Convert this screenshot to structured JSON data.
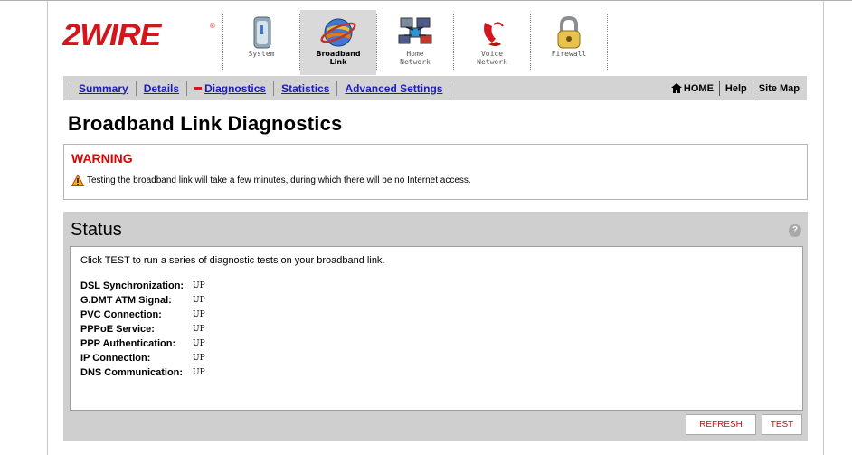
{
  "logo": {
    "text": "2WIRE",
    "reg": "®"
  },
  "topnav": [
    {
      "label": "System",
      "icon": "system-icon",
      "active": false
    },
    {
      "label": "Broadband\nLink",
      "icon": "globe-icon",
      "active": true
    },
    {
      "label": "Home\nNetwork",
      "icon": "network-icon",
      "active": false
    },
    {
      "label": "Voice\nNetwork",
      "icon": "phone-icon",
      "active": false
    },
    {
      "label": "Firewall",
      "icon": "padlock-icon",
      "active": false
    }
  ],
  "subnav": {
    "summary": "Summary",
    "details": "Details",
    "diagnostics": "Diagnostics",
    "statistics": "Statistics",
    "advanced": "Advanced Settings",
    "home": "HOME",
    "help": "Help",
    "sitemap": "Site Map"
  },
  "page_title": "Broadband Link Diagnostics",
  "warning": {
    "title": "WARNING",
    "message": "Testing the broadband link will take a few minutes, during which there will be no Internet access."
  },
  "status": {
    "title": "Status",
    "help": "?",
    "intro": "Click TEST to run a series of diagnostic tests on your broadband link.",
    "rows": [
      {
        "label": "DSL Synchronization:",
        "value": "UP"
      },
      {
        "label": "G.DMT ATM Signal:",
        "value": "UP"
      },
      {
        "label": "PVC Connection:",
        "value": "UP"
      },
      {
        "label": "PPPoE Service:",
        "value": "UP"
      },
      {
        "label": "PPP Authentication:",
        "value": "UP"
      },
      {
        "label": "IP Connection:",
        "value": "UP"
      },
      {
        "label": "DNS Communication:",
        "value": "UP"
      }
    ]
  },
  "buttons": {
    "refresh": "REFRESH",
    "test": "TEST"
  },
  "colors": {
    "brand_red": "#d4161c",
    "link_blue": "#1b1bbf",
    "panel_gray": "#cfcfcf"
  }
}
